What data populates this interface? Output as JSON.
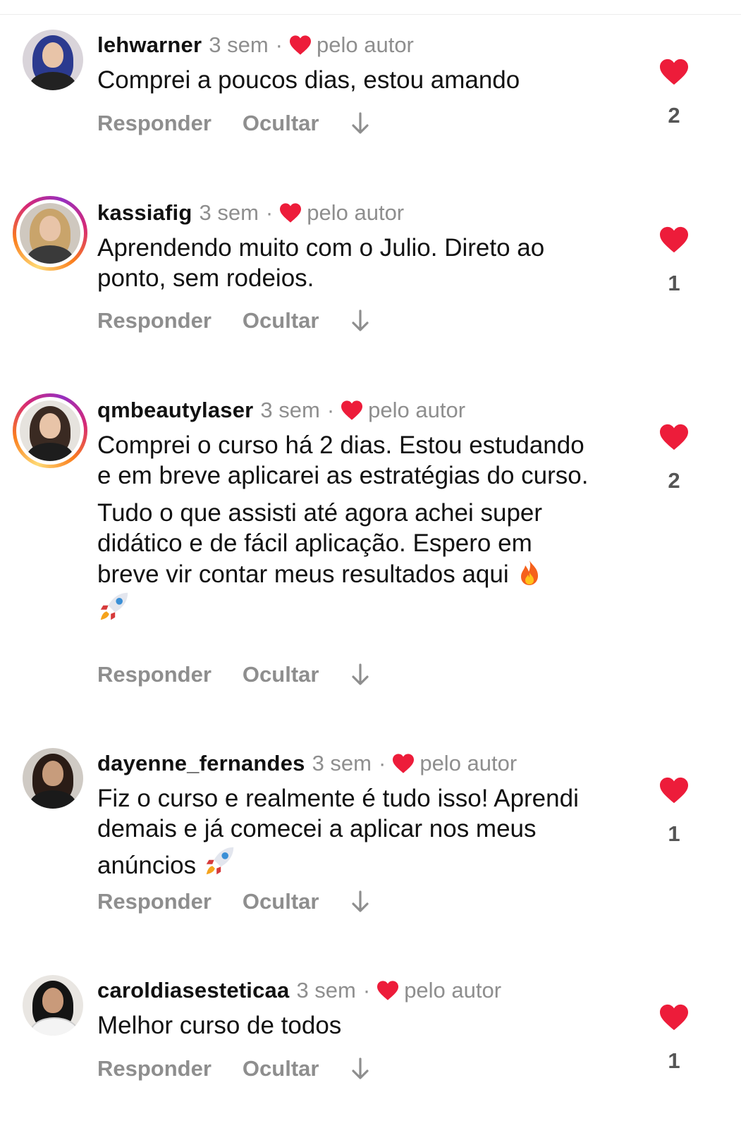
{
  "colors": {
    "heart": "#ed1c3a",
    "muted": "#8e8e8e",
    "text": "#111111"
  },
  "comments": [
    {
      "username": "lehwarner",
      "time": "3 sem",
      "separator": "·",
      "author_label": "pelo autor",
      "text": [
        "Comprei a poucos dias, estou amando"
      ],
      "reply": "Responder",
      "hide": "Ocultar",
      "likes": "2"
    },
    {
      "username": "kassiafig",
      "time": "3 sem",
      "separator": "·",
      "author_label": "pelo autor",
      "text": [
        "Aprendendo muito com o Julio. Direto ao ponto, sem rodeios."
      ],
      "reply": "Responder",
      "hide": "Ocultar",
      "likes": "1"
    },
    {
      "username": "qmbeautylaser",
      "time": "3 sem",
      "separator": "·",
      "author_label": "pelo autor",
      "text": [
        "Comprei o curso há 2 dias. Estou estudando e em breve aplicarei as estratégias do curso.",
        "Tudo o que assisti até agora achei super didático e de fácil aplicação. Espero em breve vir contar meus resultados aqui"
      ],
      "reply": "Responder",
      "hide": "Ocultar",
      "likes": "2"
    },
    {
      "username": "dayenne_fernandes",
      "time": "3 sem",
      "separator": "·",
      "author_label": "pelo autor",
      "text": [
        "Fiz o curso e realmente é tudo isso! Aprendi demais e já comecei a aplicar nos meus anúncios"
      ],
      "reply": "Responder",
      "hide": "Ocultar",
      "likes": "1"
    },
    {
      "username": "caroldiasesteticaa",
      "time": "3 sem",
      "separator": "·",
      "author_label": "pelo autor",
      "text": [
        "Melhor curso de todos"
      ],
      "reply": "Responder",
      "hide": "Ocultar",
      "likes": "1"
    }
  ],
  "icons": {
    "author_heart": "heart-icon",
    "like": "heart-icon",
    "expand": "arrow-down-icon",
    "fire": "fire-emoji",
    "rocket": "rocket-emoji"
  }
}
